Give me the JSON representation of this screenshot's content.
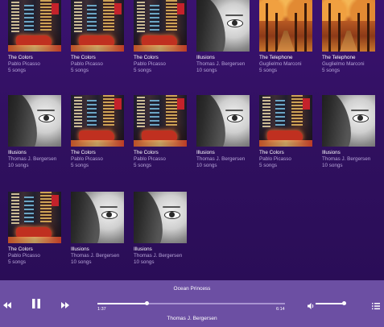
{
  "albums": [
    {
      "title": "The Colors",
      "artist": "Pablo Picasso",
      "songs": "5 songs",
      "cover": "city-night-cover"
    },
    {
      "title": "The Colors",
      "artist": "Pablo Picasso",
      "songs": "5 songs",
      "cover": "city-night-cover"
    },
    {
      "title": "The Colors",
      "artist": "Pablo Picasso",
      "songs": "5 songs",
      "cover": "city-night-cover"
    },
    {
      "title": "Illusions",
      "artist": "Thomas J. Bergersen",
      "songs": "10 songs",
      "cover": "face-cover"
    },
    {
      "title": "The Telephone",
      "artist": "Guglielmo Marconi",
      "songs": "5 songs",
      "cover": "autumn-trees-cover"
    },
    {
      "title": "The Telephone",
      "artist": "Guglielmo Marconi",
      "songs": "5 songs",
      "cover": "autumn-trees-cover"
    },
    {
      "title": "Illusions",
      "artist": "Thomas J. Bergersen",
      "songs": "10 songs",
      "cover": "face-cover"
    },
    {
      "title": "The Colors",
      "artist": "Pablo Picasso",
      "songs": "5 songs",
      "cover": "city-night-cover"
    },
    {
      "title": "The Colors",
      "artist": "Pablo Picasso",
      "songs": "5 songs",
      "cover": "city-night-cover"
    },
    {
      "title": "Illusions",
      "artist": "Thomas J. Bergersen",
      "songs": "10 songs",
      "cover": "face-cover"
    },
    {
      "title": "The Colors",
      "artist": "Pablo Picasso",
      "songs": "5 songs",
      "cover": "city-night-cover"
    },
    {
      "title": "Illusions",
      "artist": "Thomas J. Bergersen",
      "songs": "10 songs",
      "cover": "face-cover"
    },
    {
      "title": "The Colors",
      "artist": "Pablo Picasso",
      "songs": "5 songs",
      "cover": "city-night-cover"
    },
    {
      "title": "Illusions",
      "artist": "Thomas J. Bergersen",
      "songs": "10 songs",
      "cover": "face-cover"
    },
    {
      "title": "Illusions",
      "artist": "Thomas J. Bergersen",
      "songs": "10 songs",
      "cover": "face-cover"
    }
  ],
  "player": {
    "track_title": "Ocean Princess",
    "track_artist": "Thomas J. Bergersen",
    "elapsed": "1:37",
    "duration": "6:14",
    "progress_fraction": 0.26,
    "volume_fraction": 0.92,
    "icons": {
      "previous": "previous-icon",
      "pause": "pause-icon",
      "next": "next-icon",
      "volume": "volume-icon",
      "queue": "queue-list-icon"
    }
  },
  "colors": {
    "background": "#2c0e59",
    "player_bar": "#6c4fa3",
    "secondary_text": "#b7a6d9"
  }
}
